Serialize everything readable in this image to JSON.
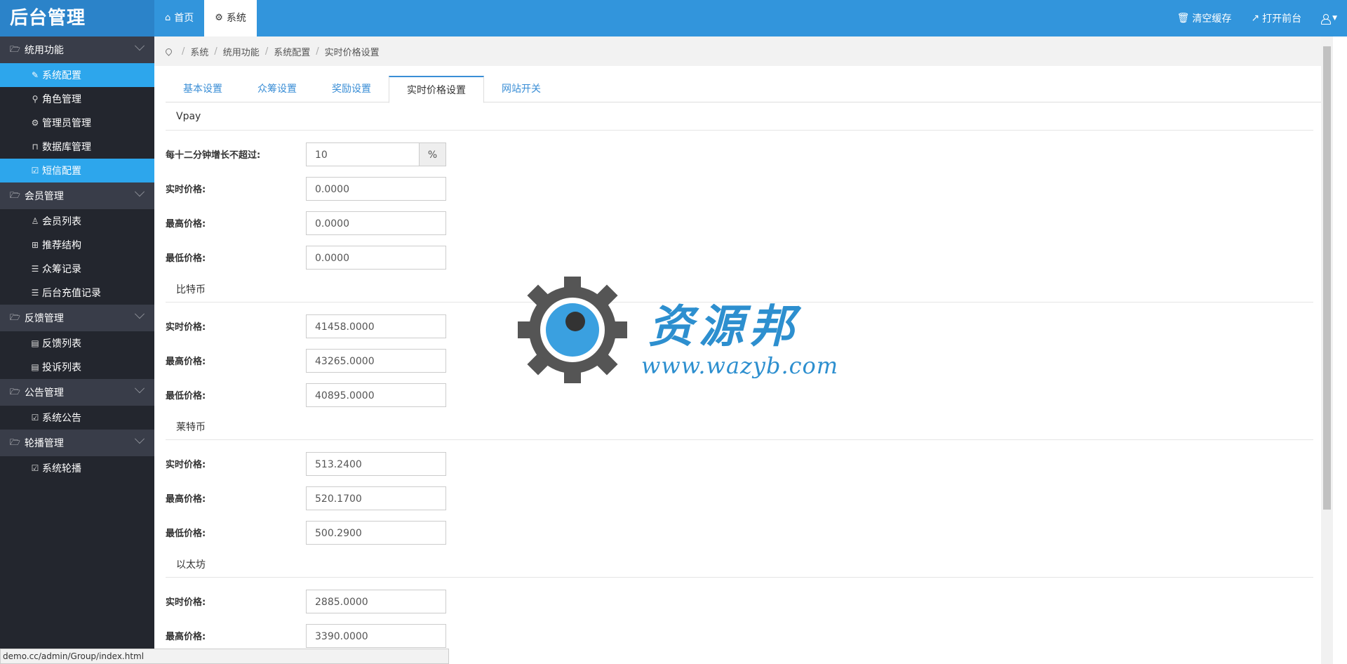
{
  "brand": "后台管理",
  "top_tabs": [
    {
      "icon": "home-icon",
      "label": "首页"
    },
    {
      "icon": "gear-icon",
      "label": "系统"
    }
  ],
  "top_right": {
    "clear_cache": "清空缓存",
    "open_frontend": "打开前台"
  },
  "sidebar": {
    "groups": [
      {
        "label": "统用功能",
        "items": [
          {
            "label": "系统配置",
            "icon": "wrench-icon",
            "active": true
          },
          {
            "label": "角色管理",
            "icon": "sitemap-icon"
          },
          {
            "label": "管理员管理",
            "icon": "gear-icon"
          },
          {
            "label": "数据库管理",
            "icon": "lock-icon"
          },
          {
            "label": "短信配置",
            "icon": "edit-icon",
            "active": true
          }
        ]
      },
      {
        "label": "会员管理",
        "items": [
          {
            "label": "会员列表",
            "icon": "user-icon"
          },
          {
            "label": "推荐结构",
            "icon": "grid-icon"
          },
          {
            "label": "众筹记录",
            "icon": "list-icon"
          },
          {
            "label": "后台充值记录",
            "icon": "list-icon"
          }
        ]
      },
      {
        "label": "反馈管理",
        "items": [
          {
            "label": "反馈列表",
            "icon": "file-icon"
          },
          {
            "label": "投诉列表",
            "icon": "file-icon"
          }
        ]
      },
      {
        "label": "公告管理",
        "items": [
          {
            "label": "系统公告",
            "icon": "edit-icon"
          }
        ]
      },
      {
        "label": "轮播管理",
        "items": [
          {
            "label": "系统轮播",
            "icon": "edit-icon"
          }
        ]
      }
    ]
  },
  "breadcrumb": [
    "系统",
    "统用功能",
    "系统配置",
    "实时价格设置"
  ],
  "tabs": [
    "基本设置",
    "众筹设置",
    "奖励设置",
    "实时价格设置",
    "网站开关"
  ],
  "active_tab": "实时价格设置",
  "form": {
    "vpay": {
      "title": "Vpay",
      "growth_label": "每十二分钟增长不超过:",
      "growth_value": "10",
      "growth_unit": "%",
      "current_label": "实时价格:",
      "current": "0.0000",
      "high_label": "最高价格:",
      "high": "0.0000",
      "low_label": "最低价格:",
      "low": "0.0000"
    },
    "btc": {
      "title": "比特币",
      "current_label": "实时价格:",
      "current": "41458.0000",
      "high_label": "最高价格:",
      "high": "43265.0000",
      "low_label": "最低价格:",
      "low": "40895.0000"
    },
    "ltc": {
      "title": "莱特币",
      "current_label": "实时价格:",
      "current": "513.2400",
      "high_label": "最高价格:",
      "high": "520.1700",
      "low_label": "最低价格:",
      "low": "500.2900"
    },
    "eth": {
      "title": "以太坊",
      "current_label": "实时价格:",
      "current": "2885.0000",
      "high_label": "最高价格:",
      "high": "3390.0000"
    }
  },
  "watermark": {
    "text": "资源邦",
    "url": "www.wazyb.com"
  },
  "status_url": "demo.cc/admin/Group/index.html",
  "colors": {
    "topbar": "#3295dc",
    "sidebar": "#23262e",
    "active_item": "#2da6ec",
    "link": "#3a8ed6"
  }
}
